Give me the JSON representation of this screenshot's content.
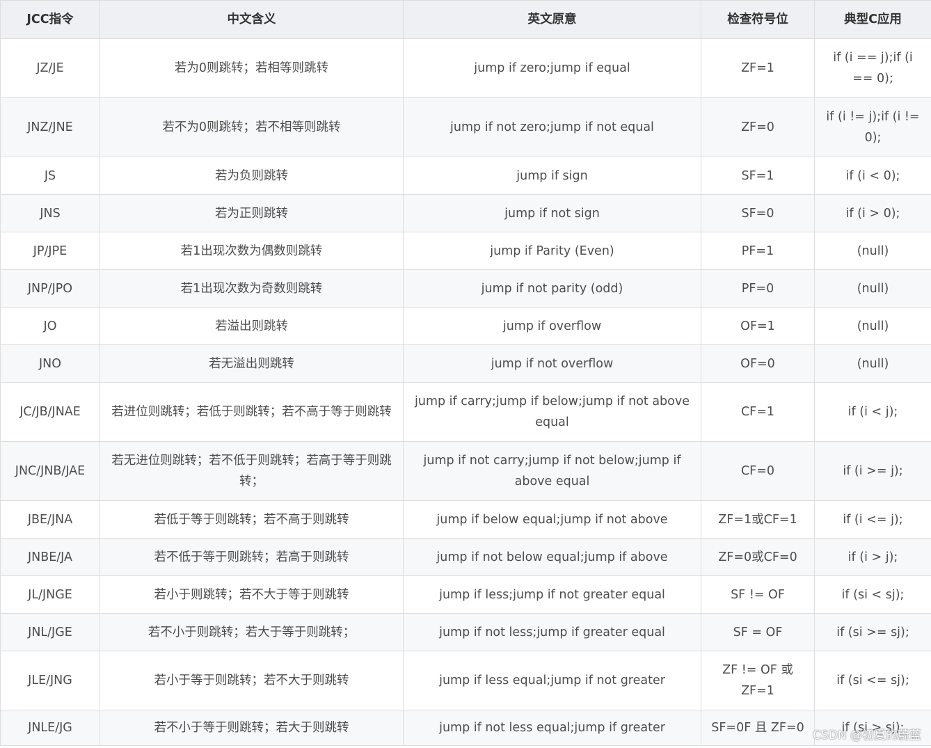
{
  "table": {
    "headers": [
      "JCC指令",
      "中文含义",
      "英文原意",
      "检查符号位",
      "典型C应用"
    ],
    "rows": [
      [
        "JZ/JE",
        "若为0则跳转；若相等则跳转",
        "jump if zero;jump if equal",
        "ZF=1",
        "if (i == j);if (i == 0);"
      ],
      [
        "JNZ/JNE",
        "若不为0则跳转；若不相等则跳转",
        "jump if not zero;jump if not equal",
        "ZF=0",
        "if (i != j);if (i != 0);"
      ],
      [
        "JS",
        "若为负则跳转",
        "jump if sign",
        "SF=1",
        "if (i < 0);"
      ],
      [
        "JNS",
        "若为正则跳转",
        "jump if not sign",
        "SF=0",
        "if (i > 0);"
      ],
      [
        "JP/JPE",
        "若1出现次数为偶数则跳转",
        "jump if Parity (Even)",
        "PF=1",
        "(null)"
      ],
      [
        "JNP/JPO",
        "若1出现次数为奇数则跳转",
        "jump if not parity (odd)",
        "PF=0",
        "(null)"
      ],
      [
        "JO",
        "若溢出则跳转",
        "jump if overflow",
        "OF=1",
        "(null)"
      ],
      [
        "JNO",
        "若无溢出则跳转",
        "jump if not overflow",
        "OF=0",
        "(null)"
      ],
      [
        "JC/JB/JNAE",
        "若进位则跳转；若低于则跳转；若不高于等于则跳转",
        "jump if carry;jump if below;jump if not above equal",
        "CF=1",
        "if (i < j);"
      ],
      [
        "JNC/JNB/JAE",
        "若无进位则跳转；若不低于则跳转；若高于等于则跳转；",
        "jump if not carry;jump if not below;jump if above equal",
        "CF=0",
        "if (i >= j);"
      ],
      [
        "JBE/JNA",
        "若低于等于则跳转；若不高于则跳转",
        "jump if below equal;jump if not above",
        "ZF=1或CF=1",
        "if (i <= j);"
      ],
      [
        "JNBE/JA",
        "若不低于等于则跳转；若高于则跳转",
        "jump if not below equal;jump if above",
        "ZF=0或CF=0",
        "if (i > j);"
      ],
      [
        "JL/JNGE",
        "若小于则跳转；若不大于等于则跳转",
        "jump if less;jump if not greater equal",
        "SF != OF",
        "if (si < sj);"
      ],
      [
        "JNL/JGE",
        "若不小于则跳转；若大于等于则跳转；",
        "jump if not less;jump if greater equal",
        "SF = OF",
        "if (si >= sj);"
      ],
      [
        "JLE/JNG",
        "若小于等于则跳转；若不大于则跳转",
        "jump if less equal;jump if not greater",
        "ZF != OF 或 ZF=1",
        "if (si <= sj);"
      ],
      [
        "JNLE/JG",
        "若不小于等于则跳转；若大于则跳转",
        "jump if not less equal;jump if greater",
        "SF=0F 且 ZF=0",
        "if (si > sj);"
      ]
    ]
  },
  "watermark": "CSDN @初夏的蔚蓝"
}
